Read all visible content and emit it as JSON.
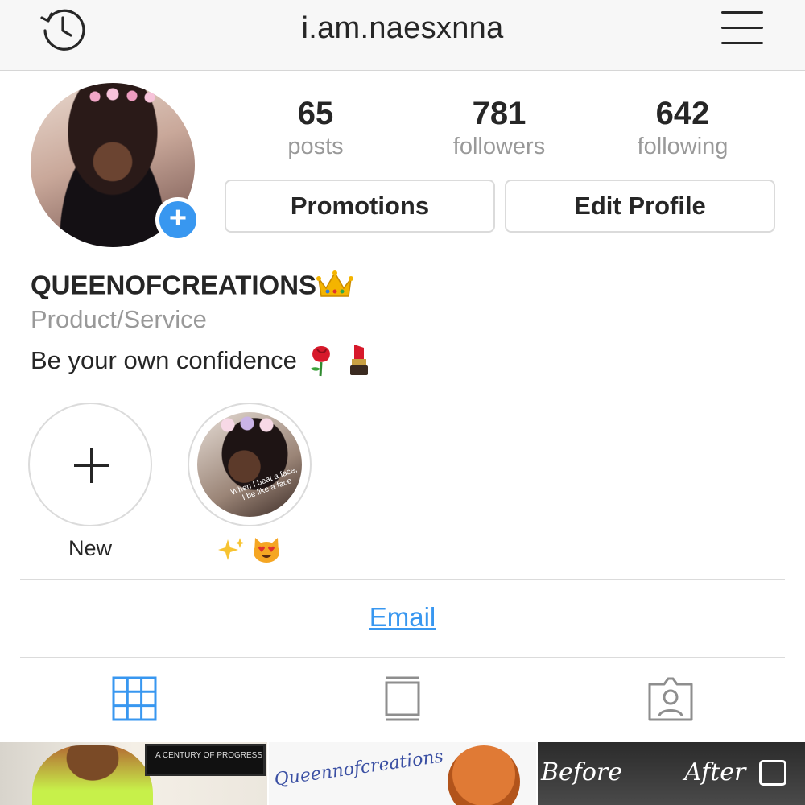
{
  "header": {
    "username": "i.am.naesxnna",
    "history_icon": "history-clock-icon",
    "menu_icon": "hamburger-menu-icon"
  },
  "profile": {
    "stats": [
      {
        "value": "65",
        "label": "posts"
      },
      {
        "value": "781",
        "label": "followers"
      },
      {
        "value": "642",
        "label": "following"
      }
    ],
    "buttons": {
      "promotions": "Promotions",
      "edit_profile": "Edit Profile"
    },
    "add_story_badge": "+",
    "name": "QUEENOFCREATIONS",
    "name_emoji": "crown",
    "category": "Product/Service",
    "bio": "Be your own confidence",
    "bio_emojis": [
      "rose",
      "lipstick"
    ]
  },
  "highlights": [
    {
      "label": "New",
      "type": "new"
    },
    {
      "label": "",
      "emojis": [
        "sparkles",
        "heart-eyes-cat"
      ],
      "caption": "When I beat a face, I be like a face"
    }
  ],
  "contact": {
    "email_label": "Email"
  },
  "tabs": [
    {
      "name": "grid",
      "icon": "grid-icon",
      "active": true
    },
    {
      "name": "feed",
      "icon": "list-feed-icon",
      "active": false
    },
    {
      "name": "tagged",
      "icon": "tagged-person-icon",
      "active": false
    }
  ],
  "grid_posts": [
    {
      "overlay_text": "A CENTURY OF PROGRESS"
    },
    {
      "overlay_text": "Queennofcreations"
    },
    {
      "overlay_before": "Before",
      "overlay_after": "After",
      "multi": true
    }
  ],
  "colors": {
    "accent": "#3897f0",
    "text": "#262626",
    "muted": "#999999",
    "border": "#dbdbdb"
  }
}
